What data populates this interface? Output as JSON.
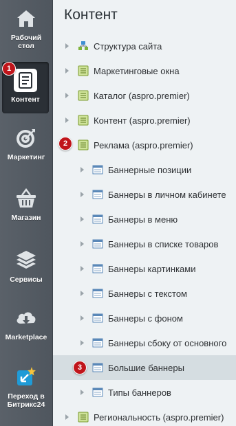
{
  "rail": {
    "items": [
      {
        "label": "Рабочий стол",
        "icon": "home-icon"
      },
      {
        "label": "Контент",
        "icon": "document-icon",
        "active": true
      },
      {
        "label": "Маркетинг",
        "icon": "target-icon"
      },
      {
        "label": "Магазин",
        "icon": "basket-icon"
      },
      {
        "label": "Сервисы",
        "icon": "layers-icon"
      },
      {
        "label": "Marketplace",
        "icon": "cloud-download-icon"
      },
      {
        "label": "Переход в Битрикс24",
        "icon": "bitrix24-icon"
      }
    ]
  },
  "main": {
    "title": "Контент",
    "tree": [
      {
        "label": "Структура сайта",
        "icon": "site-structure-icon",
        "level": 0
      },
      {
        "label": "Маркетинговые окна",
        "icon": "list-icon",
        "level": 0
      },
      {
        "label": "Каталог (aspro.premier)",
        "icon": "list-icon",
        "level": 0
      },
      {
        "label": "Контент (aspro.premier)",
        "icon": "list-icon",
        "level": 0
      },
      {
        "label": "Реклама (aspro.premier)",
        "icon": "list-icon",
        "level": 0
      },
      {
        "label": "Баннерные позиции",
        "icon": "iblock-icon",
        "level": 1
      },
      {
        "label": "Баннеры в личном кабинете",
        "icon": "iblock-icon",
        "level": 1
      },
      {
        "label": "Баннеры в меню",
        "icon": "iblock-icon",
        "level": 1
      },
      {
        "label": "Баннеры в списке товаров",
        "icon": "iblock-icon",
        "level": 1
      },
      {
        "label": "Баннеры картинками",
        "icon": "iblock-icon",
        "level": 1
      },
      {
        "label": "Баннеры с текстом",
        "icon": "iblock-icon",
        "level": 1
      },
      {
        "label": "Баннеры с фоном",
        "icon": "iblock-icon",
        "level": 1
      },
      {
        "label": "Баннеры сбоку от основного",
        "icon": "iblock-icon",
        "level": 1
      },
      {
        "label": "Большие баннеры",
        "icon": "iblock-icon",
        "level": 1,
        "selected": true
      },
      {
        "label": "Типы баннеров",
        "icon": "iblock-icon",
        "level": 1
      },
      {
        "label": "Региональность (aspro.premier)",
        "icon": "list-icon",
        "level": 0
      }
    ]
  },
  "badges": [
    "1",
    "2",
    "3"
  ],
  "colors": {
    "rail": "#555c63",
    "badge": "#c0151b",
    "panel": "#eef2f4",
    "selected_row": "#d5dde1"
  }
}
